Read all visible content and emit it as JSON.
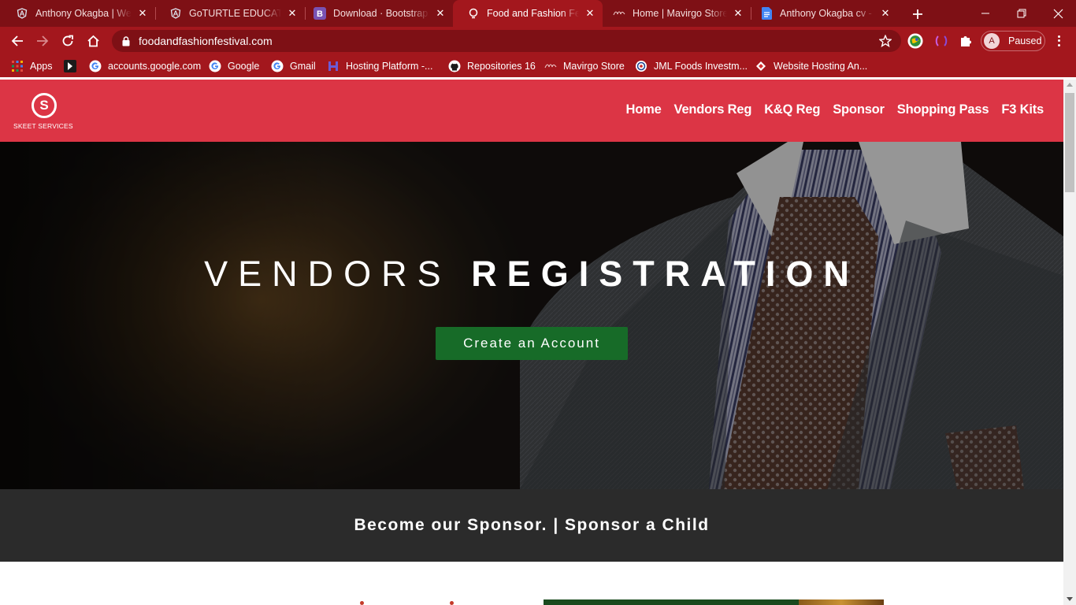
{
  "browser": {
    "tabs": [
      {
        "title": "Anthony Okagba | Web",
        "icon": "angular-icon"
      },
      {
        "title": "GoTURTLE EDUCATION",
        "icon": "angular-icon"
      },
      {
        "title": "Download · Bootstrap v",
        "icon": "bootstrap-icon"
      },
      {
        "title": "Food and Fashion Festi",
        "icon": "site-favicon",
        "active": true
      },
      {
        "title": "Home | Mavirgo Store",
        "icon": "mavirgo-icon"
      },
      {
        "title": "Anthony Okagba cv - G",
        "icon": "google-docs-icon"
      }
    ],
    "url": "foodandfashionfestival.com",
    "profile_initial": "A",
    "profile_status": "Paused",
    "bookmarks": [
      {
        "label": "Apps",
        "icon": "apps-grid-icon"
      },
      {
        "label": "",
        "icon": "bookmark-logo-icon"
      },
      {
        "label": "accounts.google.com",
        "icon": "google-icon"
      },
      {
        "label": "Google",
        "icon": "google-icon"
      },
      {
        "label": "Gmail",
        "icon": "google-icon"
      },
      {
        "label": "Hosting Platform -...",
        "icon": "hosting-icon"
      },
      {
        "label": "Repositories 16",
        "icon": "github-icon"
      },
      {
        "label": "Mavirgo Store",
        "icon": "mavirgo-icon"
      },
      {
        "label": "JML Foods Investm...",
        "icon": "jml-icon"
      },
      {
        "label": "Website Hosting An...",
        "icon": "hosting-diamond-icon"
      }
    ]
  },
  "site": {
    "logo_letter": "S",
    "logo_text": "SKEET SERVICES",
    "nav": [
      "Home",
      "Vendors Reg",
      "K&Q Reg",
      "Sponsor",
      "Shopping Pass",
      "F3 Kits"
    ],
    "hero": {
      "title_light": "VENDORS",
      "title_bold": "REGISTRATION",
      "cta": "Create an Account"
    },
    "banner": "Become our Sponsor. | Sponsor a Child"
  },
  "colors": {
    "brand_red": "#dc3545",
    "browser_red": "#a3171d",
    "cta_green": "#176b28",
    "banner_dark": "#2b2b2b"
  }
}
